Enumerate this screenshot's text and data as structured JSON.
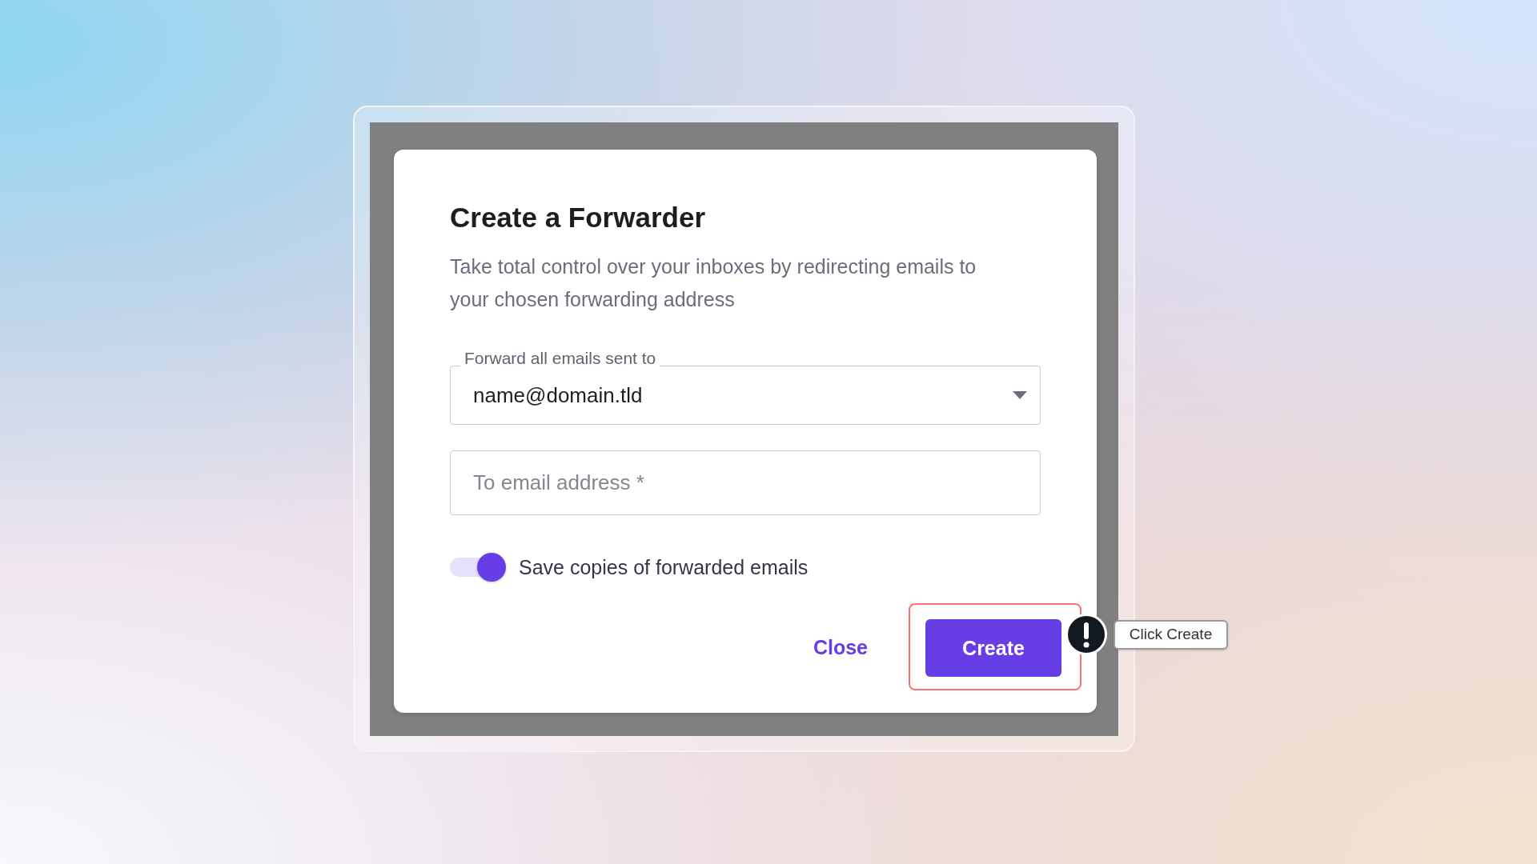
{
  "dialog": {
    "title": "Create a Forwarder",
    "description": "Take total control over your inboxes by redirecting emails to your chosen forwarding address",
    "fields": [
      {
        "kind": "select",
        "label": "Forward all emails sent to",
        "value": "name@domain.tld"
      },
      {
        "kind": "text",
        "placeholder": "To email address *"
      }
    ],
    "toggle": {
      "label": "Save copies of forwarded emails",
      "on": true
    },
    "buttons": [
      {
        "kind": "text",
        "label": "Close",
        "highlighted": false
      },
      {
        "kind": "primary",
        "label": "Create",
        "highlighted": true,
        "hint": "Click Create"
      }
    ]
  }
}
